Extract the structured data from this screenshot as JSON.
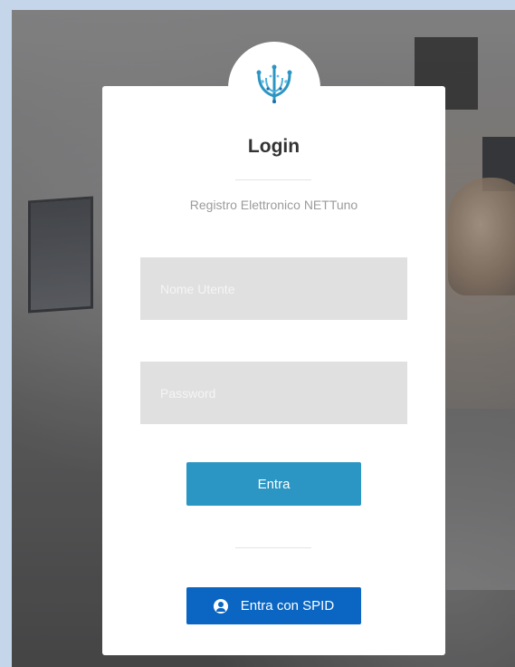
{
  "login": {
    "title": "Login",
    "subtitle": "Registro Elettronico NETTuno",
    "username_placeholder": "Nome Utente",
    "password_placeholder": "Password",
    "submit_label": "Entra",
    "spid_label": "Entra con SPID"
  },
  "logo": {
    "icon": "trident-logo-icon",
    "color": "#2b95c3"
  },
  "colors": {
    "primary_button": "#2b95c3",
    "spid_button": "#0a66c2",
    "input_background": "#e0e0e0",
    "page_frame": "#c5d5ea"
  }
}
